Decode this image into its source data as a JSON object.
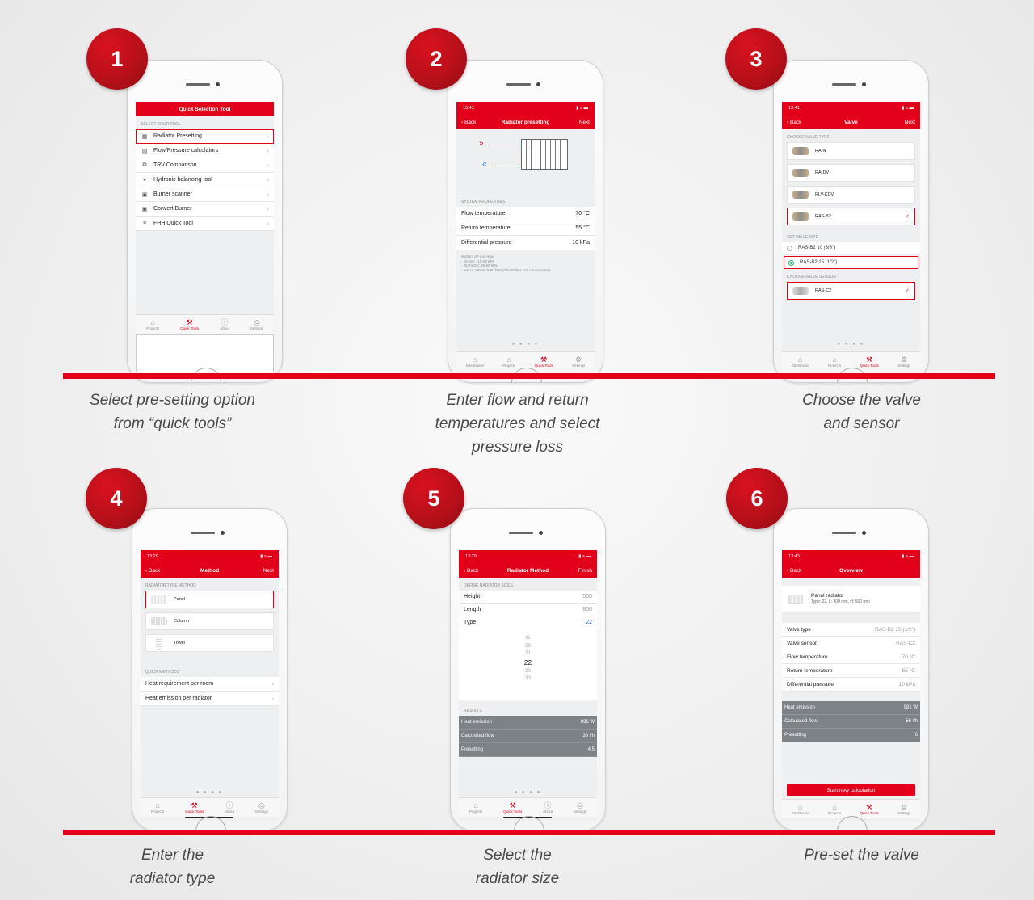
{
  "steps": [
    {
      "num": "1",
      "caption": [
        "Select pre-setting option",
        "from “quick tools”"
      ]
    },
    {
      "num": "2",
      "caption": [
        "Enter flow and return",
        "temperatures and select",
        "pressure loss"
      ]
    },
    {
      "num": "3",
      "caption": [
        "Choose the valve",
        "and sensor"
      ]
    },
    {
      "num": "4",
      "caption": [
        "Enter the",
        "radiator type"
      ]
    },
    {
      "num": "5",
      "caption": [
        "Select the",
        "radiator size"
      ]
    },
    {
      "num": "6",
      "caption": [
        "Pre-set the valve"
      ]
    }
  ],
  "s1": {
    "title": "Quick Selection Tool",
    "section": "SELECT YOUR TOOL",
    "items": [
      "Radiator Presetting",
      "Flow/Pressure calculators",
      "TRV Comparison",
      "Hydronic balancing tool",
      "Burner scanner",
      "Convert Burner",
      "FHH Quick Tool"
    ],
    "icons": [
      "▦",
      "▤",
      "⧉",
      "◒",
      "▣",
      "▣",
      "≡"
    ],
    "tabs": [
      "Projects",
      "Quick Tools",
      "About",
      "Settings"
    ]
  },
  "s2": {
    "time": "13:41",
    "status": "▮ ≡ ▬",
    "back": "Back",
    "title": "Radiator presetting",
    "next": "Next",
    "flow_arrow": "»",
    "return_arrow": "«",
    "section": "SYSTEM PROPERTIES",
    "rows": [
      {
        "label": "Flow temperature",
        "value": "70 °C"
      },
      {
        "label": "Return temperature",
        "value": "55 °C"
      },
      {
        "label": "Differential pressure",
        "value": "10 kPa"
      }
    ],
    "note": [
      "System dP min-max",
      "- RA-DV : 10-60 kPa",
      "- RLV-KDV: 15-60 kPa",
      "- rest of valves: 5-60 kPa (dP>30 kPa can cause noise)"
    ],
    "dots": "● ● ● ●",
    "tabs": [
      "Dashboard",
      "Projects",
      "Quick Tools",
      "Settings"
    ]
  },
  "s3": {
    "time": "13:41",
    "status": "▮ ≡ ▬",
    "back": "Back",
    "title": "Valve",
    "next": "Next",
    "section_type": "CHOOSE VALVE TYPE",
    "valves": [
      "RA-N",
      "RA-DV",
      "RLV-KDV",
      "RAS-B2"
    ],
    "check": "✓",
    "section_size": "SET VALVE SIZE",
    "sizes": [
      "RAS-B2 10 (3/8\")",
      "RAS-B2 15 (1/2\")"
    ],
    "section_sensor": "CHOOSE VALVE SENSOR",
    "sensor": "RAS-C2",
    "dots": "● ● ● ●",
    "tabs": [
      "Dashboard",
      "Projects",
      "Quick Tools",
      "Settings"
    ]
  },
  "s4": {
    "time": "13:29",
    "status": "▮ ≡ ▬",
    "back": "Back",
    "title": "Method",
    "next": "Next",
    "section_type": "RADIATOR TYPE METHOD",
    "types": [
      "Panel",
      "Column",
      "Towel"
    ],
    "section_quick": "QUICK METHODS",
    "quick": [
      "Heat requirement per room",
      "Heat emission per radiator"
    ],
    "dots": "● ● ● ●",
    "tabs": [
      "Projects",
      "Quick Tools",
      "About",
      "Settings"
    ]
  },
  "s5": {
    "time": "13:29",
    "status": "▮ ≡ ▬",
    "back": "Back",
    "title": "Radiator Method",
    "next": "Finish",
    "section_sizes": "DEFINE RADIATOR SIZES",
    "sizes": [
      {
        "label": "Height",
        "value": "500"
      },
      {
        "label": "Length",
        "value": "800"
      },
      {
        "label": "Type",
        "value": "22"
      }
    ],
    "picker": [
      "11",
      "20",
      "21",
      "22",
      "30",
      "33"
    ],
    "section_results": "RESULTS",
    "results": [
      {
        "label": "Heat emission",
        "value": "896 W"
      },
      {
        "label": "Calculated flow",
        "value": "39 l/h"
      },
      {
        "label": "Presetting",
        "value": "4.5"
      }
    ],
    "dots": "● ● ● ●",
    "tabs": [
      "Projects",
      "Quick Tools",
      "About",
      "Settings"
    ]
  },
  "s6": {
    "time": "13:43",
    "status": "▮ ≡ ▬",
    "back": "Back",
    "title": "Overview",
    "radiator": "Panel radiator",
    "radiator_spec": "Type: 22, L: 800 mm, H: 500 mm",
    "rows": [
      {
        "label": "Valve type",
        "value": "RAS-B2 15 (1/2\")"
      },
      {
        "label": "Valve sensor",
        "value": "RAS-C2"
      },
      {
        "label": "Flow temperature",
        "value": "70 °C"
      },
      {
        "label": "Return temperature",
        "value": "55 °C"
      },
      {
        "label": "Differential pressure",
        "value": "10 kPa"
      }
    ],
    "results": [
      {
        "label": "Heat emission",
        "value": "981 W"
      },
      {
        "label": "Calculated flow",
        "value": "56 l/h"
      },
      {
        "label": "Presetting",
        "value": "6"
      }
    ],
    "button": "Start new calculation",
    "tabs": [
      "Dashboard",
      "Projects",
      "Quick Tools",
      "Settings"
    ]
  },
  "tab_icons": {
    "home": "⌂",
    "tools": "⚒",
    "info": "ⓘ",
    "gear": "⚙",
    "globe": "◎"
  },
  "colors": {
    "accent": "#e2001a",
    "result_bg": "#7d8287",
    "check": "#e2001a",
    "radio_on": "#2bb673"
  }
}
